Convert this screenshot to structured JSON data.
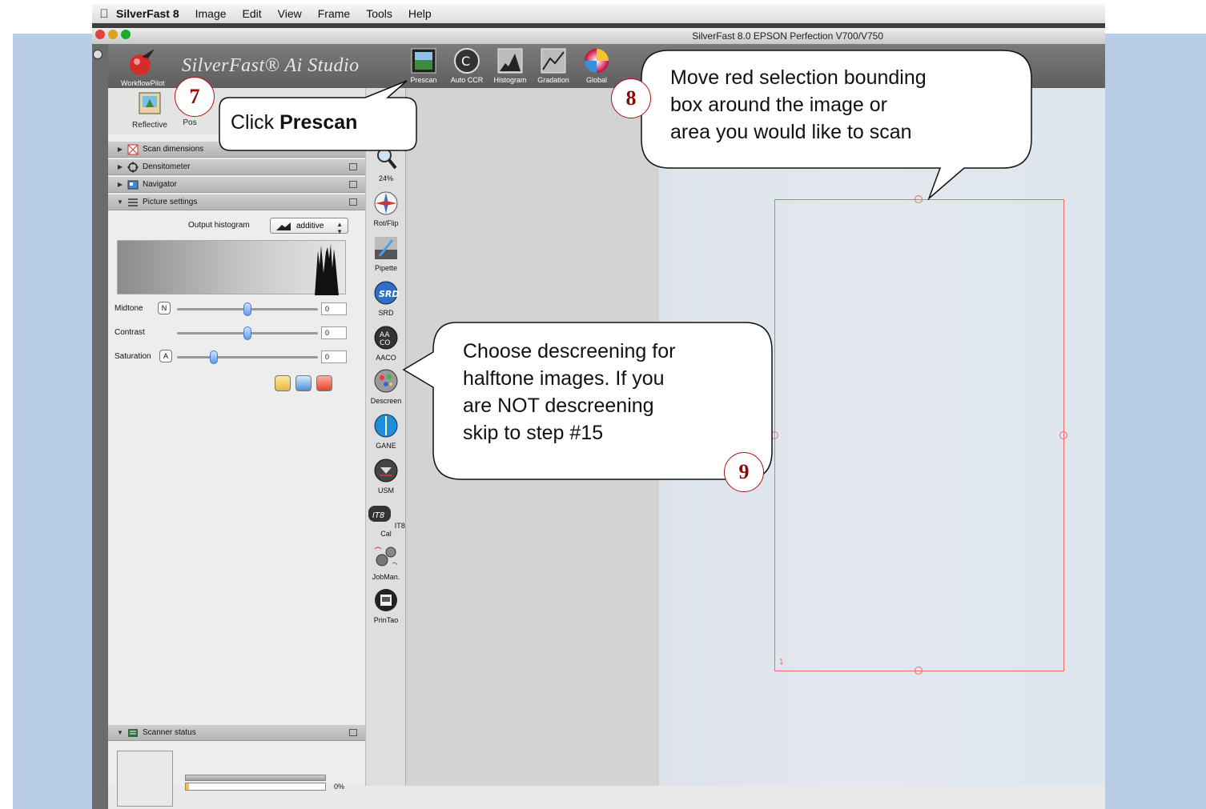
{
  "menubar": {
    "app_name": "SilverFast 8",
    "items": [
      "Image",
      "Edit",
      "View",
      "Frame",
      "Tools",
      "Help"
    ]
  },
  "window": {
    "title": "SilverFast 8.0 EPSON Perfection V700/V750"
  },
  "toolbar": {
    "workflow_label": "WorkflowPilot",
    "brand": "SilverFast® Ai Studio",
    "buttons": [
      "Prescan",
      "Auto CCR",
      "Histogram",
      "Gradation",
      "Global"
    ]
  },
  "modes": [
    "Reflective",
    "Pos"
  ],
  "sections": {
    "scan_dimensions": "Scan dimensions",
    "densitometer": "Densitometer",
    "navigator": "Navigator",
    "picture_settings": "Picture settings",
    "scanner_status": "Scanner status"
  },
  "picture_settings": {
    "output_histogram_label": "Output histogram",
    "output_histogram_value": "additive",
    "sliders": [
      {
        "label": "Midtone",
        "button": "N",
        "value": "0",
        "level": 0.5
      },
      {
        "label": "Contrast",
        "button": "",
        "value": "0",
        "level": 0.5
      },
      {
        "label": "Saturation",
        "button": "A",
        "value": "0",
        "level": 0.26
      }
    ]
  },
  "scanner_status": {
    "progress_text": "0%",
    "progress": 0.02
  },
  "tools": [
    {
      "label": "24%",
      "icon": "zoom-icon"
    },
    {
      "label": "Rot/Flip",
      "icon": "compass-icon"
    },
    {
      "label": "Pipette",
      "icon": "pipette-icon"
    },
    {
      "label": "SRD",
      "icon": "srd-icon"
    },
    {
      "label": "AACO",
      "icon": "aaco-icon"
    },
    {
      "label": "Descreen",
      "icon": "descreen-icon"
    },
    {
      "label": "GANE",
      "icon": "gane-icon"
    },
    {
      "label": "USM",
      "icon": "usm-icon"
    },
    {
      "label": "IT8 Cal",
      "icon": "it8-icon"
    },
    {
      "label": "JobMan.",
      "icon": "gears-icon"
    },
    {
      "label": "PrinTao",
      "icon": "printao-icon"
    }
  ],
  "selection": {
    "frame_number": "1",
    "color": "#f26a6a"
  },
  "callouts": {
    "c7": {
      "step": "7",
      "prefix": "Click ",
      "bold": "Prescan"
    },
    "c8": {
      "step": "8",
      "line1": "Move red selection bounding",
      "line2": "box around the image or",
      "line3": "area you would like to scan"
    },
    "c9": {
      "step": "9",
      "line1": "Choose descreening for",
      "line2": "halftone images. If you",
      "line3": "are NOT descreening",
      "line4": "skip to step #15"
    }
  },
  "colors": {
    "background_blue": "#b8cde4",
    "step_red": "#8b0a0a"
  }
}
